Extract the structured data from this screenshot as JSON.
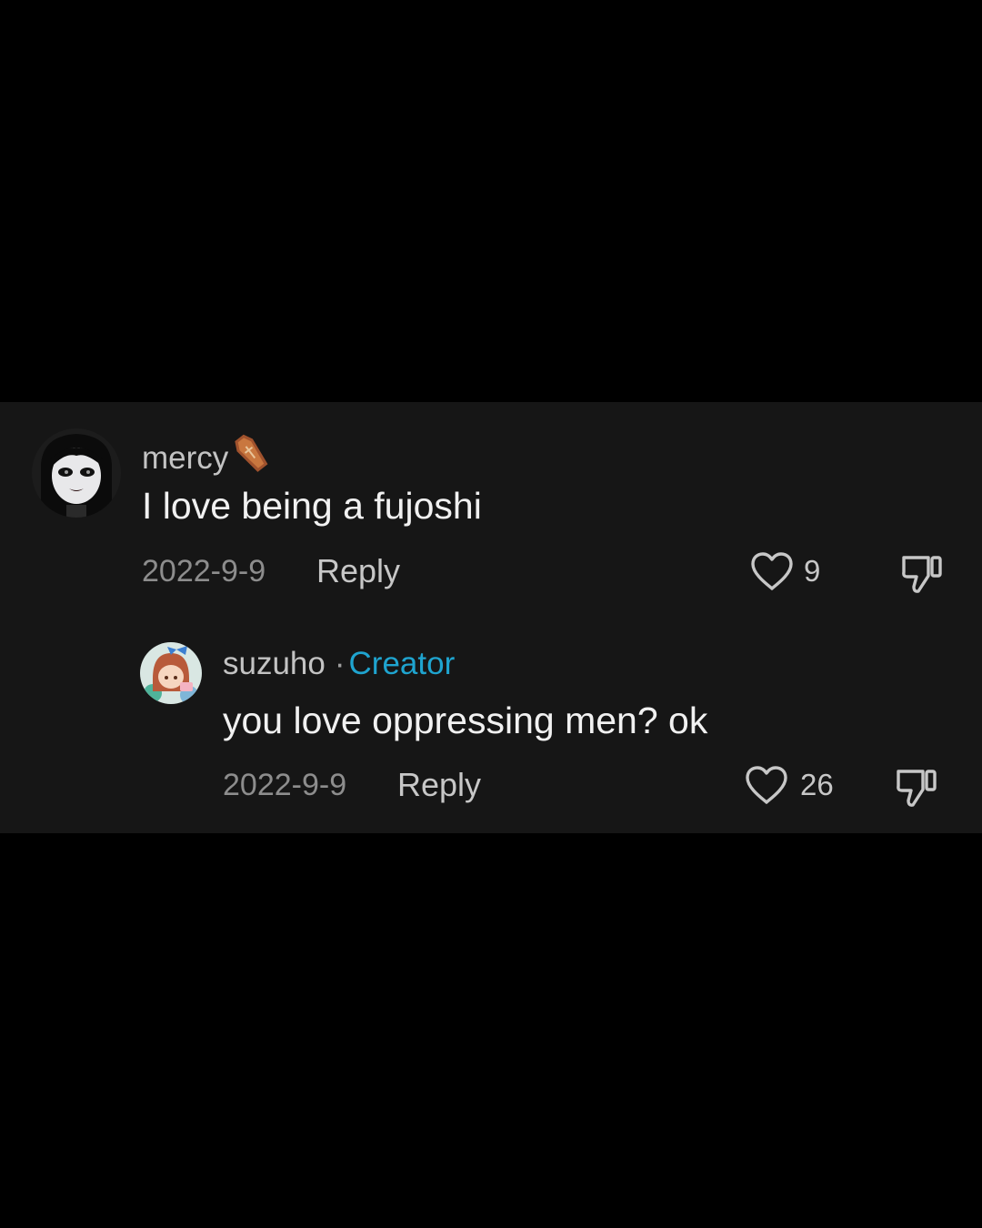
{
  "comments": [
    {
      "username": "mercy",
      "username_badge_icon": "coffin-emoji-icon",
      "text": "I love being a fujoshi",
      "date": "2022-9-9",
      "reply_label": "Reply",
      "likes": "9"
    }
  ],
  "replies": [
    {
      "username": "suzuho",
      "separator": "·",
      "creator_label": "Creator",
      "text": "you love oppressing men? ok",
      "date": "2022-9-9",
      "reply_label": "Reply",
      "likes": "26"
    }
  ],
  "colors": {
    "background": "#000000",
    "panel": "#161616",
    "creator_accent": "#1fa4cf",
    "text_primary": "#f1f1f1",
    "text_secondary": "#8d8d8d"
  },
  "icons": [
    "heart-outline-icon",
    "thumbs-down-icon"
  ]
}
